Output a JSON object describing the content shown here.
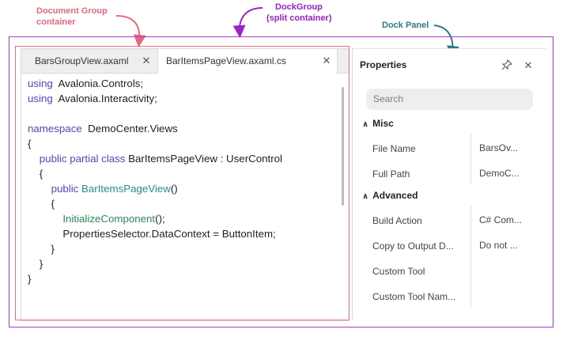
{
  "annotations": {
    "document_group": [
      "Document Group",
      "container"
    ],
    "dock_group": [
      "DockGroup",
      "(split container)"
    ],
    "dock_panel": "Dock Panel",
    "colors": {
      "document_group": "#e8697a",
      "dock_group": "#9b22c9",
      "dock_panel": "#2e7a86"
    }
  },
  "document_tabs": [
    {
      "label": "BarsGroupView.axaml",
      "active": false,
      "close_icon": "close-icon"
    },
    {
      "label": "BarItemsPageView.axaml.cs",
      "active": true,
      "close_icon": "close-icon"
    }
  ],
  "code_lines": [
    [
      [
        "kw",
        "using"
      ],
      [
        "",
        "  Avalonia.Controls;"
      ]
    ],
    [
      [
        "kw",
        "using"
      ],
      [
        "",
        "  Avalonia.Interactivity;"
      ]
    ],
    [],
    [
      [
        "kw",
        "namespace"
      ],
      [
        "",
        "  DemoCenter.Views"
      ]
    ],
    [
      [
        "",
        "{"
      ]
    ],
    [
      [
        "",
        "    "
      ],
      [
        "kw",
        "public partial class"
      ],
      [
        "",
        " BarItemsPageView : UserControl"
      ]
    ],
    [
      [
        "",
        "    {"
      ]
    ],
    [
      [
        "",
        "        "
      ],
      [
        "kw",
        "public"
      ],
      [
        "",
        " "
      ],
      [
        "type",
        "BarItemsPageView"
      ],
      [
        "",
        "()"
      ]
    ],
    [
      [
        "",
        "        {"
      ]
    ],
    [
      [
        "",
        "            "
      ],
      [
        "fn",
        "InitializeComponent"
      ],
      [
        "",
        "();"
      ]
    ],
    [
      [
        "",
        "            PropertiesSelector.DataContext = ButtonItem;"
      ]
    ],
    [
      [
        "",
        "        }"
      ]
    ],
    [
      [
        "",
        "    }"
      ]
    ],
    [
      [
        "",
        "}"
      ]
    ]
  ],
  "properties_panel": {
    "title": "Properties",
    "pin_icon": "pin-icon",
    "close_icon": "close-icon",
    "search_placeholder": "Search",
    "categories": [
      {
        "name": "Misc",
        "rows": [
          {
            "name": "File Name",
            "value": "BarsOv..."
          },
          {
            "name": "Full Path",
            "value": "DemoC..."
          }
        ]
      },
      {
        "name": "Advanced",
        "rows": [
          {
            "name": "Build Action",
            "value": "C# Com..."
          },
          {
            "name": "Copy to Output D...",
            "value": "Do not ..."
          },
          {
            "name": "Custom Tool",
            "value": ""
          },
          {
            "name": "Custom Tool Nam...",
            "value": ""
          }
        ]
      }
    ]
  }
}
